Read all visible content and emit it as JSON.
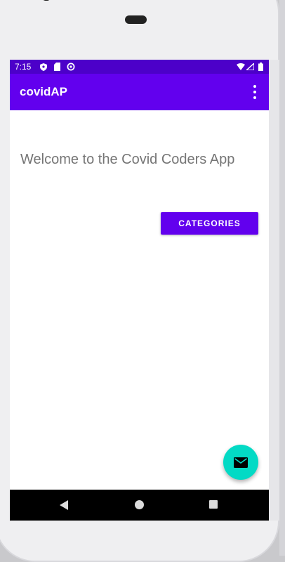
{
  "status_bar": {
    "time": "7:15",
    "icons": [
      "shield-icon",
      "sd-card-icon",
      "sync-icon",
      "wifi-icon",
      "signal-icon",
      "battery-icon"
    ],
    "background": "#4c00c9"
  },
  "app_bar": {
    "title": "covidAP",
    "background": "#6200ee",
    "menu_icon": "overflow-menu-icon"
  },
  "main": {
    "welcome_text": "Welcome to the Covid Coders App",
    "categories_button": "CATEGORIES"
  },
  "fab": {
    "icon": "mail-icon",
    "color": "#03dac5"
  },
  "nav_bar": {
    "buttons": [
      "back-icon",
      "home-icon",
      "recents-icon"
    ]
  },
  "colors": {
    "primary": "#6200ee",
    "primary_dark": "#4c00c9",
    "accent": "#03dac5"
  }
}
